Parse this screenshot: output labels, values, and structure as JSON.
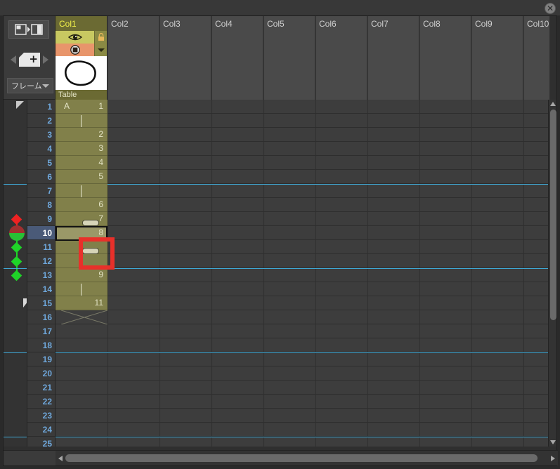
{
  "window": {
    "close_label": "✕",
    "close_icon": "close-icon"
  },
  "toolbar": {
    "layout_toggle_icon": "panel-layout-toggle-icon",
    "prev_icon": "prev-arrow-icon",
    "next_icon": "next-arrow-icon",
    "new_frame_icon": "new-frame-plus-icon",
    "mode_dropdown_value": "フレーム",
    "mode_dropdown_caret": "chevron-down-icon"
  },
  "columns": [
    {
      "name": "Col1",
      "active": true,
      "level_label": "Table",
      "eye_icon": "eye-visible-icon",
      "lock_icon": "lock-icon",
      "render_icon": "render-toggle-icon",
      "menu_icon": "chevron-down-icon",
      "thumbnail": "hand-drawn-oval-sketch"
    },
    {
      "name": "Col2",
      "active": false
    },
    {
      "name": "Col3",
      "active": false
    },
    {
      "name": "Col4",
      "active": false
    },
    {
      "name": "Col5",
      "active": false
    },
    {
      "name": "Col6",
      "active": false
    },
    {
      "name": "Col7",
      "active": false
    },
    {
      "name": "Col8",
      "active": false
    },
    {
      "name": "Col9",
      "active": false
    },
    {
      "name": "Col10",
      "active": false
    }
  ],
  "rows": [
    {
      "frame": "1",
      "level": "A",
      "value": "1",
      "continuation": false,
      "current": false
    },
    {
      "frame": "2",
      "level": "",
      "value": "",
      "continuation": true,
      "current": false
    },
    {
      "frame": "3",
      "level": "",
      "value": "2",
      "continuation": false,
      "current": false
    },
    {
      "frame": "4",
      "level": "",
      "value": "3",
      "continuation": false,
      "current": false
    },
    {
      "frame": "5",
      "level": "",
      "value": "4",
      "continuation": false,
      "current": false
    },
    {
      "frame": "6",
      "level": "",
      "value": "5",
      "continuation": false,
      "current": false
    },
    {
      "frame": "7",
      "level": "",
      "value": "",
      "continuation": true,
      "current": false
    },
    {
      "frame": "8",
      "level": "",
      "value": "6",
      "continuation": false,
      "current": false
    },
    {
      "frame": "9",
      "level": "",
      "value": "7",
      "continuation": false,
      "current": false
    },
    {
      "frame": "10",
      "level": "",
      "value": "8",
      "continuation": false,
      "current": true
    },
    {
      "frame": "11",
      "level": "",
      "value": "",
      "continuation": true,
      "current": false
    },
    {
      "frame": "12",
      "level": "",
      "value": "",
      "continuation": true,
      "current": false
    },
    {
      "frame": "13",
      "level": "",
      "value": "9",
      "continuation": false,
      "current": false
    },
    {
      "frame": "14",
      "level": "",
      "value": "",
      "continuation": true,
      "current": false
    },
    {
      "frame": "15",
      "level": "",
      "value": "11",
      "continuation": false,
      "current": false
    },
    {
      "frame": "16",
      "level": "",
      "value": "",
      "continuation": false,
      "current": false,
      "end_marker": true
    },
    {
      "frame": "17",
      "level": "",
      "value": "",
      "continuation": false,
      "current": false
    },
    {
      "frame": "18",
      "level": "",
      "value": "",
      "continuation": false,
      "current": false
    },
    {
      "frame": "19",
      "level": "",
      "value": "",
      "continuation": false,
      "current": false
    },
    {
      "frame": "20",
      "level": "",
      "value": "",
      "continuation": false,
      "current": false
    },
    {
      "frame": "21",
      "level": "",
      "value": "",
      "continuation": false,
      "current": false
    },
    {
      "frame": "22",
      "level": "",
      "value": "",
      "continuation": false,
      "current": false
    },
    {
      "frame": "23",
      "level": "",
      "value": "",
      "continuation": false,
      "current": false
    },
    {
      "frame": "24",
      "level": "",
      "value": "",
      "continuation": false,
      "current": false
    },
    {
      "frame": "25",
      "level": "",
      "value": "",
      "continuation": false,
      "current": false
    }
  ],
  "keyframes": [
    {
      "frame": "9",
      "type": "diamond",
      "color": "#ee2222",
      "name": "keyframe-marker-red"
    },
    {
      "frame": "10",
      "type": "circle",
      "color": "#a03030",
      "name": "keyframe-playhead-marker"
    },
    {
      "frame": "11",
      "type": "diamond",
      "color": "#1fd428",
      "name": "keyframe-marker-green"
    },
    {
      "frame": "12",
      "type": "diamond",
      "color": "#1fd428",
      "name": "keyframe-marker-green"
    },
    {
      "frame": "13",
      "type": "diamond",
      "color": "#1fd428",
      "name": "keyframe-marker-green"
    }
  ],
  "marker_lines": [
    7,
    13,
    19,
    25
  ],
  "selection": {
    "highlight_box_color": "#e8302a",
    "start_frame": "11",
    "end_frame": "12"
  },
  "drag_handles": [
    {
      "frame": "9",
      "name": "cell-drag-handle"
    },
    {
      "frame": "11",
      "name": "cell-drag-handle"
    }
  ],
  "scrollbars": {
    "vertical_up_icon": "scroll-up-arrow-icon",
    "vertical_down_icon": "scroll-down-arrow-icon",
    "horizontal_left_icon": "scroll-left-arrow-icon",
    "horizontal_right_icon": "scroll-right-arrow-icon"
  }
}
